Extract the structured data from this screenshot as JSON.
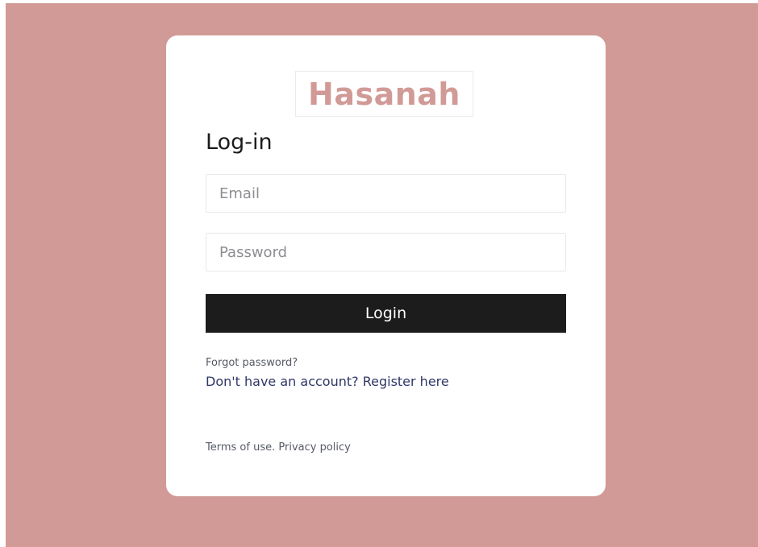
{
  "colors": {
    "background": "#d19a96",
    "card": "#ffffff",
    "brand": "#d19a96",
    "button": "#1c1c1c",
    "link": "#2f3766"
  },
  "logo": {
    "text": "Hasanah"
  },
  "form": {
    "title": "Log-in",
    "email": {
      "placeholder": "Email",
      "value": ""
    },
    "password": {
      "placeholder": "Password",
      "value": ""
    },
    "login_label": "Login"
  },
  "links": {
    "forgot_password": "Forgot password?",
    "no_account": "Don't have an account?",
    "register": "Register here"
  },
  "footer": {
    "terms": "Terms of use.",
    "privacy": "Privacy policy"
  }
}
